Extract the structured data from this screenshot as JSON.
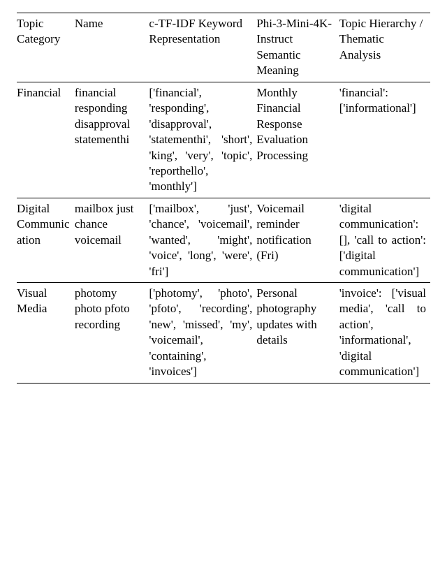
{
  "headers": {
    "c1": "Topic Category",
    "c2": "Name",
    "c3": "c-TF-IDF Keyword Representation",
    "c4": "Phi-3-Mini-4K-Instruct Semantic Meaning",
    "c5": "Topic Hierarchy / Thematic Analysis"
  },
  "rows": [
    {
      "category": "Financial",
      "name": "financial responding disapproval statementhi",
      "keywords": "['financial', 'responding', 'disapproval', 'statementhi', 'short', 'king', 'very', 'topic', 'reporthello', 'monthly']",
      "semantic": "Monthly Financial Response Evaluation Processing",
      "hierarchy": "'financial': ['informational']"
    },
    {
      "category": "Digital Communication",
      "name": "mailbox just chance voicemail",
      "keywords": "['mailbox', 'just', 'chance', 'voicemail', 'wanted', 'might', 'voice', 'long', 'were', 'fri']",
      "semantic": "Voicemail reminder notification (Fri)",
      "hierarchy": "'digital communication': [], 'call to action': ['digital communication']"
    },
    {
      "category": "Visual Media",
      "name": "photomy photo pfoto recording",
      "keywords": "['photomy', 'photo', 'pfoto', 'recording', 'new', 'missed', 'my', 'voicemail', 'containing', 'invoices']",
      "semantic": "Personal photography updates with details",
      "hierarchy": "'invoice': ['visual media', 'call to action', 'informational', 'digital communication']"
    }
  ]
}
